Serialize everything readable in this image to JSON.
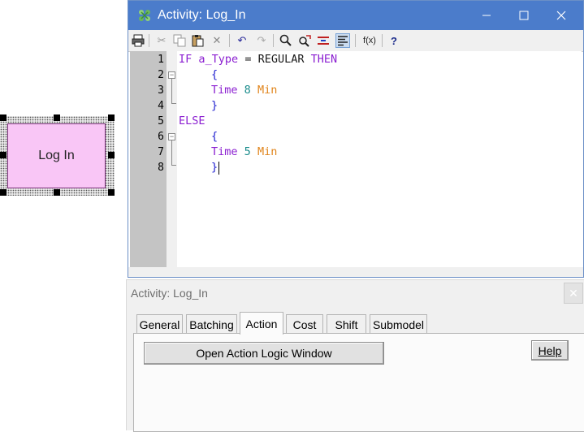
{
  "canvas": {
    "block_label": "Log In",
    "block_fill": "#f9c6f6"
  },
  "editor": {
    "title": "Activity: Log_In",
    "title_icon": "activity-icon",
    "controls": {
      "minimize": "minimize-icon",
      "maximize": "maximize-icon",
      "close": "close-icon"
    },
    "toolbar": [
      "print-icon",
      "cut-icon",
      "copy-icon",
      "paste-icon",
      "delete-icon",
      "undo-icon",
      "redo-icon",
      "find-icon",
      "replace-icon",
      "toggle-bookmark-icon",
      "format-icon",
      "function-icon",
      "help-icon"
    ],
    "function_label": "f(x)",
    "help_label": "?",
    "line_numbers": [
      "1",
      "2",
      "3",
      "4",
      "5",
      "6",
      "7",
      "8"
    ],
    "code": {
      "l1_if": "IF",
      "l1_var": "a_Type",
      "l1_eq": "=",
      "l1_val": "REGULAR",
      "l1_then": "THEN",
      "l2": "{",
      "l3_fn": "Time",
      "l3_num": "8",
      "l3_unit": "Min",
      "l4": "}",
      "l5": "ELSE",
      "l6": "{",
      "l7_fn": "Time",
      "l7_num": "5",
      "l7_unit": "Min",
      "l8": "}"
    },
    "colors": {
      "keyword": "#8b1fd1",
      "number": "#1a8c8c",
      "unit": "#e0841a",
      "brace": "#2020d0",
      "titlebar": "#4b7ccb"
    }
  },
  "properties": {
    "title": "Activity: Log_In",
    "tabs": [
      "General",
      "Batching",
      "Action",
      "Cost",
      "Shift",
      "Submodel"
    ],
    "active_tab": "Action",
    "open_logic_button": "Open Action Logic Window",
    "help_button": "Help"
  }
}
